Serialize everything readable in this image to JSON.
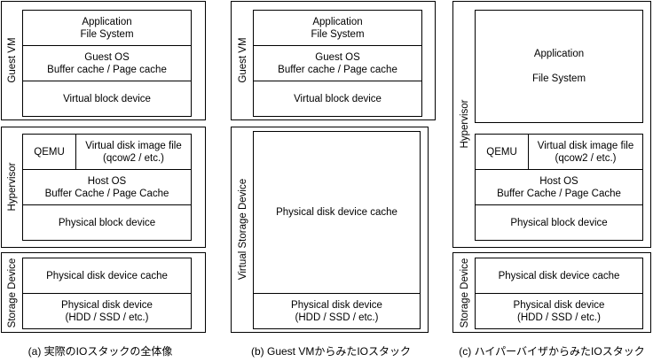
{
  "a": {
    "guest_label": "Guest VM",
    "app_line1": "Application",
    "app_line2": "File System",
    "guest_os_line1": "Guest OS",
    "guest_os_line2": "Buffer cache / Page cache",
    "virtual_block": "Virtual block device",
    "hypervisor_label": "Hypervisor",
    "qemu": "QEMU",
    "vdisk_line1": "Virtual disk image file",
    "vdisk_line2": "(qcow2 / etc.)",
    "host_os_line1": "Host OS",
    "host_os_line2": "Buffer Cache / Page Cache",
    "physical_block": "Physical block device",
    "storage_label": "Storage Device",
    "pd_cache": "Physical disk device cache",
    "pd_line1": "Physical disk device",
    "pd_line2": "(HDD / SSD / etc.)",
    "caption": "(a) 実際のIOスタックの全体像"
  },
  "b": {
    "guest_label": "Guest VM",
    "app_line1": "Application",
    "app_line2": "File System",
    "guest_os_line1": "Guest OS",
    "guest_os_line2": "Buffer cache / Page cache",
    "virtual_block": "Virtual block device",
    "vstorage_label": "Virtual Storage Device",
    "pd_cache": "Physical disk device cache",
    "pd_line1": "Physical disk device",
    "pd_line2": "(HDD / SSD / etc.)",
    "caption": "(b) Guest VMからみたIOスタック"
  },
  "c": {
    "hypervisor_label": "Hypervisor",
    "app_line1": "Application",
    "app_line2": "File System",
    "qemu": "QEMU",
    "vdisk_line1": "Virtual disk image file",
    "vdisk_line2": "(qcow2 / etc.)",
    "host_os_line1": "Host OS",
    "host_os_line2": "Buffer Cache / Page Cache",
    "physical_block": "Physical block device",
    "storage_label": "Storage Device",
    "pd_cache": "Physical disk device cache",
    "pd_line1": "Physical disk device",
    "pd_line2": "(HDD / SSD / etc.)",
    "caption": "(c) ハイパーバイザからみたIOスタック"
  }
}
